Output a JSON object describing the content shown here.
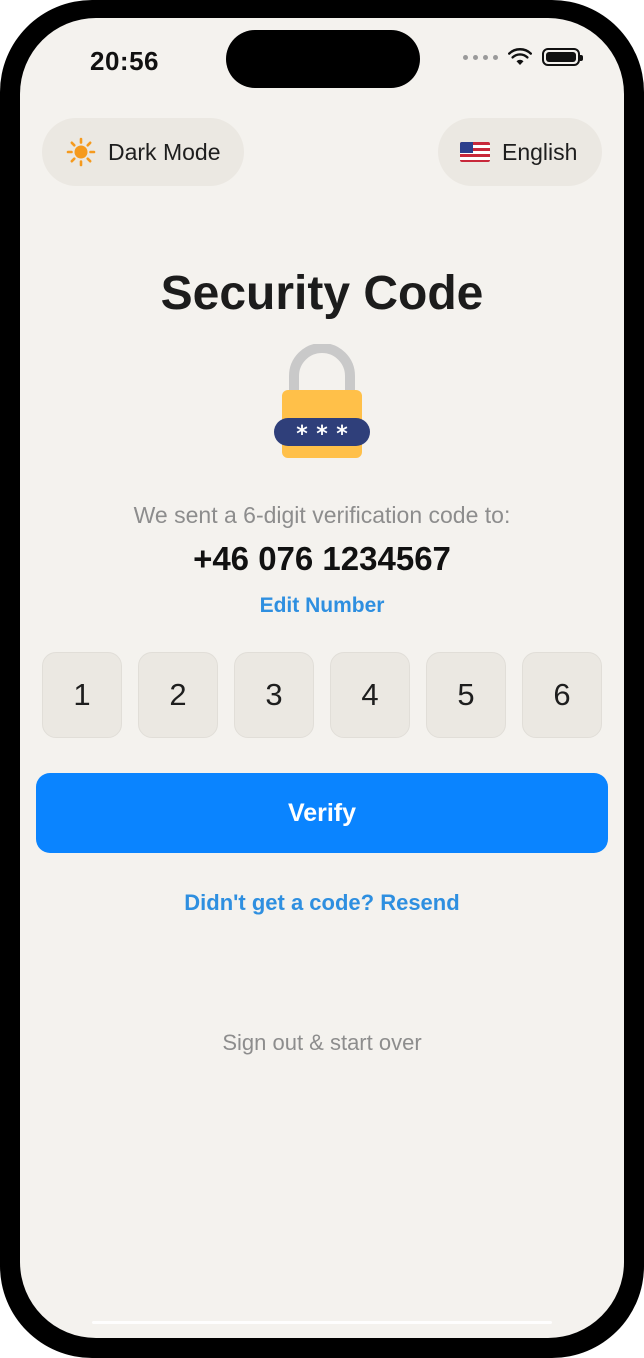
{
  "status_bar": {
    "time": "20:56",
    "icons": [
      "wifi-icon",
      "battery-icon"
    ]
  },
  "top_bar": {
    "dark_mode_label": "Dark Mode",
    "dark_mode_icon": "sun-icon",
    "language_label": "English",
    "language_icon": "us-flag-icon"
  },
  "main": {
    "title": "Security Code",
    "lock_icon": "padlock-icon",
    "subtitle": "We sent a 6-digit verification code to:",
    "phone_number": "+46 076 1234567",
    "edit_label": "Edit Number",
    "code_digits": [
      "1",
      "2",
      "3",
      "4",
      "5",
      "6"
    ],
    "verify_label": "Verify",
    "resend_label": "Didn't get a code? Resend",
    "signout_label": "Sign out & start over"
  },
  "colors": {
    "background": "#f4f2ee",
    "accent": "#0a84ff",
    "link": "#2e8fe0",
    "lock_body": "#ffc049",
    "lock_band": "#2f3f7a"
  }
}
